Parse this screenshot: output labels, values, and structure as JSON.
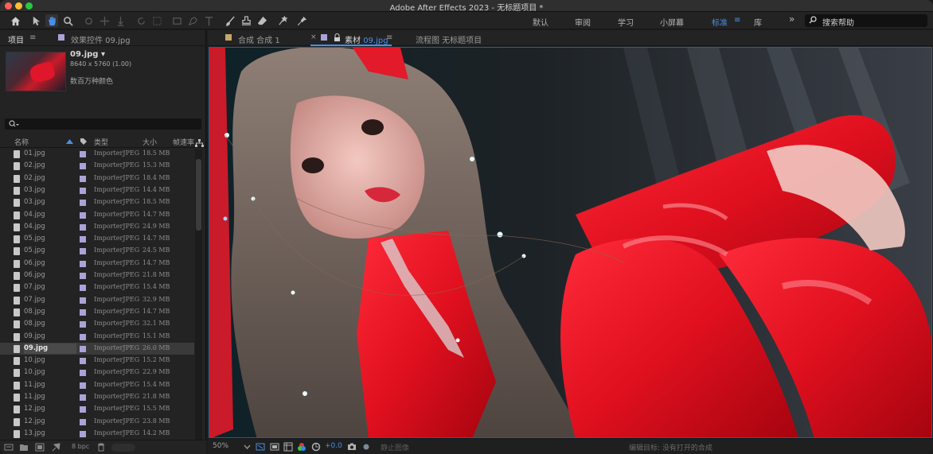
{
  "window": {
    "title": "Adobe After Effects 2023 - 无标题项目 *"
  },
  "workspaces": {
    "items": [
      "默认",
      "审阅",
      "学习",
      "小屏幕",
      "标准",
      "库"
    ],
    "active": "标准",
    "overflow": "»"
  },
  "help_search": {
    "value": "搜索帮助"
  },
  "project_panel": {
    "tab_project": "项目",
    "tab_effects": "效果控件 09.jpg",
    "file_name": "09.jpg ▾",
    "file_dims": "8640 x 5760 (1.00)",
    "file_color": "数百万种颜色",
    "search_placeholder": "",
    "columns": {
      "name": "名称",
      "type": "类型",
      "size": "大小",
      "fps": "帧速率"
    },
    "rows": [
      {
        "name": "01.jpg",
        "type": "ImporterJPEG",
        "size": "18.5 MB"
      },
      {
        "name": "02.jpg",
        "type": "ImporterJPEG",
        "size": "15.3 MB"
      },
      {
        "name": "02.jpg",
        "type": "ImporterJPEG",
        "size": "18.4 MB"
      },
      {
        "name": "03.jpg",
        "type": "ImporterJPEG",
        "size": "14.4 MB"
      },
      {
        "name": "03.jpg",
        "type": "ImporterJPEG",
        "size": "18.5 MB"
      },
      {
        "name": "04.jpg",
        "type": "ImporterJPEG",
        "size": "14.7 MB"
      },
      {
        "name": "04.jpg",
        "type": "ImporterJPEG",
        "size": "24.9 MB"
      },
      {
        "name": "05.jpg",
        "type": "ImporterJPEG",
        "size": "14.7 MB"
      },
      {
        "name": "05.jpg",
        "type": "ImporterJPEG",
        "size": "24.5 MB"
      },
      {
        "name": "06.jpg",
        "type": "ImporterJPEG",
        "size": "14.7 MB"
      },
      {
        "name": "06.jpg",
        "type": "ImporterJPEG",
        "size": "21.8 MB"
      },
      {
        "name": "07.jpg",
        "type": "ImporterJPEG",
        "size": "15.4 MB"
      },
      {
        "name": "07.jpg",
        "type": "ImporterJPEG",
        "size": "32.9 MB"
      },
      {
        "name": "08.jpg",
        "type": "ImporterJPEG",
        "size": "14.7 MB"
      },
      {
        "name": "08.jpg",
        "type": "ImporterJPEG",
        "size": "32.1 MB"
      },
      {
        "name": "09.jpg",
        "type": "ImporterJPEG",
        "size": "15.1 MB"
      },
      {
        "name": "09.jpg",
        "type": "ImporterJPEG",
        "size": "26.0 MB"
      },
      {
        "name": "10.jpg",
        "type": "ImporterJPEG",
        "size": "15.2 MB"
      },
      {
        "name": "10.jpg",
        "type": "ImporterJPEG",
        "size": "22.9 MB"
      },
      {
        "name": "11.jpg",
        "type": "ImporterJPEG",
        "size": "15.4 MB"
      },
      {
        "name": "11.jpg",
        "type": "ImporterJPEG",
        "size": "21.8 MB"
      },
      {
        "name": "12.jpg",
        "type": "ImporterJPEG",
        "size": "15.5 MB"
      },
      {
        "name": "12.jpg",
        "type": "ImporterJPEG",
        "size": "23.8 MB"
      },
      {
        "name": "13.jpg",
        "type": "ImporterJPEG",
        "size": "14.2 MB"
      }
    ],
    "selected_row": 16,
    "bit_depth": "8 bpc"
  },
  "viewer": {
    "tab_comp": "合成 合成 1",
    "tab_footage_prefix": "素材",
    "tab_footage_name": "09.jpg",
    "tab_flowchart": "流程图 无标题项目",
    "zoom": "50%",
    "exposure": "+0.0",
    "freeze_label": "静止图像",
    "edit_target": "编辑目标: 没有打开的合成"
  },
  "colors": {
    "accent": "#4a8fe7",
    "label": "#a9a3d8",
    "close": "#ff5f57",
    "minimize": "#febc2e",
    "zoom": "#28c840"
  }
}
